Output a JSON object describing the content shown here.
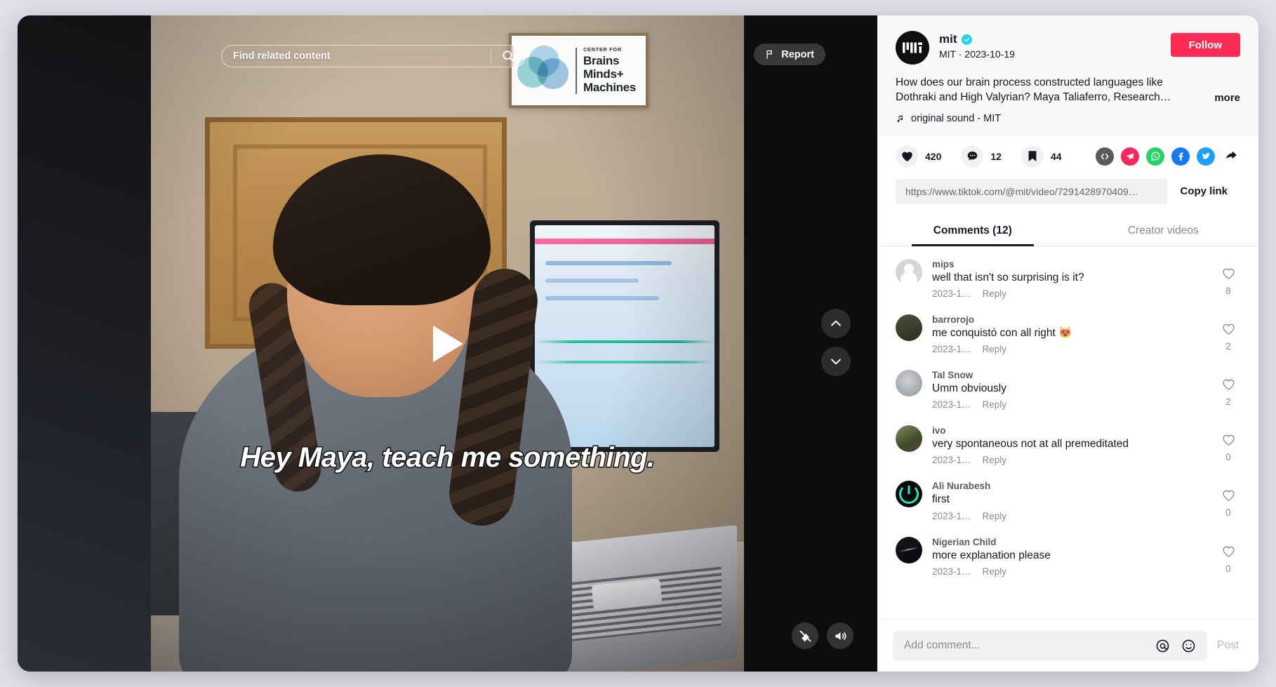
{
  "video": {
    "search_placeholder": "Find related content",
    "search_value": "",
    "search_icon": "search-icon",
    "report_label": "Report",
    "caption_text": "Hey Maya, teach me something.",
    "poster": {
      "eyebrow": "CENTER FOR",
      "line1": "Brains",
      "line2": "Minds+",
      "line3": "Machines"
    },
    "controls": {
      "play": "play-icon",
      "prev": "chevron-up-icon",
      "next": "chevron-down-icon",
      "captions_off": "captions-off-icon",
      "volume": "volume-on-icon"
    }
  },
  "panel": {
    "author": {
      "username": "mit",
      "verified": true,
      "subline": "MIT · 2023-10-19",
      "avatar_label": "MIT",
      "follow_label": "Follow"
    },
    "description": "How does our brain process constructed languages like Dothraki and High Valyrian? Maya Taliaferro, Research…",
    "more_label": "more",
    "music": "original sound - MIT",
    "stats": {
      "likes": "420",
      "comments": "12",
      "bookmarks": "44"
    },
    "share": {
      "embed": "embed-code-icon",
      "telegram": "telegram-icon",
      "whatsapp": "whatsapp-icon",
      "facebook": "facebook-icon",
      "twitter": "twitter-icon",
      "more": "share-arrow-icon"
    },
    "link": {
      "url": "https://www.tiktok.com/@mit/video/7291428970409…",
      "copy_label": "Copy link"
    },
    "tabs": [
      {
        "label": "Comments (12)",
        "active": true
      },
      {
        "label": "Creator videos",
        "active": false
      }
    ],
    "comments": [
      {
        "name": "mips",
        "text": "well that isn't so surprising is it?",
        "date": "2023-1…",
        "reply": "Reply",
        "likes": "8",
        "avatar": "av-default"
      },
      {
        "name": "barrorojo",
        "text": "me conquistó con all right 😻",
        "date": "2023-1…",
        "reply": "Reply",
        "likes": "2",
        "avatar": "av-a"
      },
      {
        "name": "Tal Snow",
        "text": "Umm obviously",
        "date": "2023-1…",
        "reply": "Reply",
        "likes": "2",
        "avatar": "av-b"
      },
      {
        "name": "ivo",
        "text": "very spontaneous not at all premeditated",
        "date": "2023-1…",
        "reply": "Reply",
        "likes": "0",
        "avatar": "av-c"
      },
      {
        "name": "Ali Nurabesh",
        "text": "first",
        "date": "2023-1…",
        "reply": "Reply",
        "likes": "0",
        "avatar": "av-d"
      },
      {
        "name": "Nigerian Child",
        "text": "more explanation please",
        "date": "2023-1…",
        "reply": "Reply",
        "likes": "0",
        "avatar": "av-e"
      }
    ],
    "composer": {
      "placeholder": "Add comment...",
      "value": "",
      "mention_icon": "at-mention-icon",
      "emoji_icon": "emoji-icon",
      "post_label": "Post"
    }
  },
  "colors": {
    "accent": "#fe2c55",
    "verified": "#20d5ec",
    "whatsapp": "#25d366",
    "facebook": "#1877f2",
    "twitter": "#1da1f2",
    "telegram": "#f5275c",
    "panel_bg": "#ffffff",
    "page_bg": "#e2e1ea"
  }
}
